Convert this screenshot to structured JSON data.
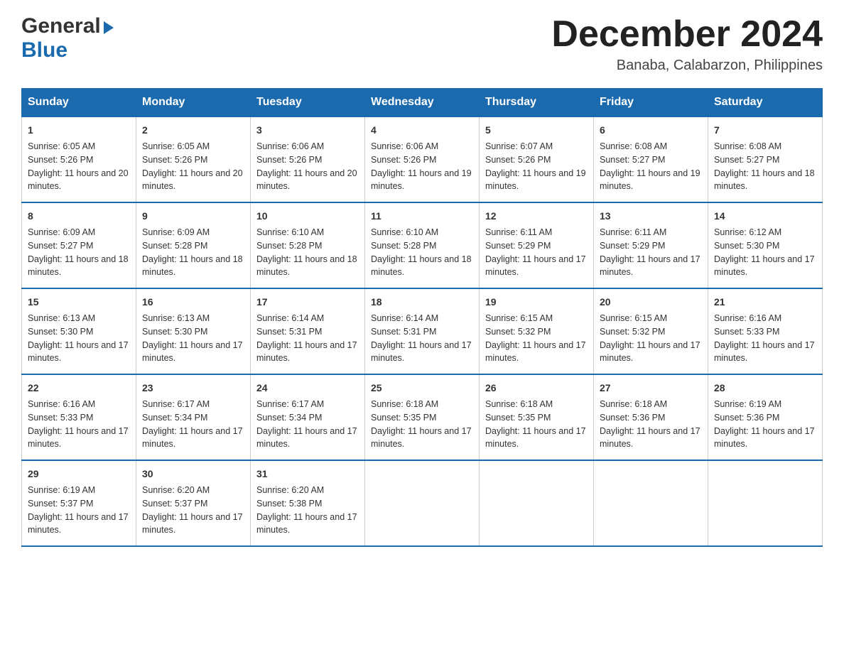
{
  "header": {
    "logo_general": "General",
    "logo_blue": "Blue",
    "month_title": "December 2024",
    "location": "Banaba, Calabarzon, Philippines"
  },
  "calendar": {
    "days_of_week": [
      "Sunday",
      "Monday",
      "Tuesday",
      "Wednesday",
      "Thursday",
      "Friday",
      "Saturday"
    ],
    "weeks": [
      [
        {
          "day": "1",
          "sunrise": "6:05 AM",
          "sunset": "5:26 PM",
          "daylight": "11 hours and 20 minutes."
        },
        {
          "day": "2",
          "sunrise": "6:05 AM",
          "sunset": "5:26 PM",
          "daylight": "11 hours and 20 minutes."
        },
        {
          "day": "3",
          "sunrise": "6:06 AM",
          "sunset": "5:26 PM",
          "daylight": "11 hours and 20 minutes."
        },
        {
          "day": "4",
          "sunrise": "6:06 AM",
          "sunset": "5:26 PM",
          "daylight": "11 hours and 19 minutes."
        },
        {
          "day": "5",
          "sunrise": "6:07 AM",
          "sunset": "5:26 PM",
          "daylight": "11 hours and 19 minutes."
        },
        {
          "day": "6",
          "sunrise": "6:08 AM",
          "sunset": "5:27 PM",
          "daylight": "11 hours and 19 minutes."
        },
        {
          "day": "7",
          "sunrise": "6:08 AM",
          "sunset": "5:27 PM",
          "daylight": "11 hours and 18 minutes."
        }
      ],
      [
        {
          "day": "8",
          "sunrise": "6:09 AM",
          "sunset": "5:27 PM",
          "daylight": "11 hours and 18 minutes."
        },
        {
          "day": "9",
          "sunrise": "6:09 AM",
          "sunset": "5:28 PM",
          "daylight": "11 hours and 18 minutes."
        },
        {
          "day": "10",
          "sunrise": "6:10 AM",
          "sunset": "5:28 PM",
          "daylight": "11 hours and 18 minutes."
        },
        {
          "day": "11",
          "sunrise": "6:10 AM",
          "sunset": "5:28 PM",
          "daylight": "11 hours and 18 minutes."
        },
        {
          "day": "12",
          "sunrise": "6:11 AM",
          "sunset": "5:29 PM",
          "daylight": "11 hours and 17 minutes."
        },
        {
          "day": "13",
          "sunrise": "6:11 AM",
          "sunset": "5:29 PM",
          "daylight": "11 hours and 17 minutes."
        },
        {
          "day": "14",
          "sunrise": "6:12 AM",
          "sunset": "5:30 PM",
          "daylight": "11 hours and 17 minutes."
        }
      ],
      [
        {
          "day": "15",
          "sunrise": "6:13 AM",
          "sunset": "5:30 PM",
          "daylight": "11 hours and 17 minutes."
        },
        {
          "day": "16",
          "sunrise": "6:13 AM",
          "sunset": "5:30 PM",
          "daylight": "11 hours and 17 minutes."
        },
        {
          "day": "17",
          "sunrise": "6:14 AM",
          "sunset": "5:31 PM",
          "daylight": "11 hours and 17 minutes."
        },
        {
          "day": "18",
          "sunrise": "6:14 AM",
          "sunset": "5:31 PM",
          "daylight": "11 hours and 17 minutes."
        },
        {
          "day": "19",
          "sunrise": "6:15 AM",
          "sunset": "5:32 PM",
          "daylight": "11 hours and 17 minutes."
        },
        {
          "day": "20",
          "sunrise": "6:15 AM",
          "sunset": "5:32 PM",
          "daylight": "11 hours and 17 minutes."
        },
        {
          "day": "21",
          "sunrise": "6:16 AM",
          "sunset": "5:33 PM",
          "daylight": "11 hours and 17 minutes."
        }
      ],
      [
        {
          "day": "22",
          "sunrise": "6:16 AM",
          "sunset": "5:33 PM",
          "daylight": "11 hours and 17 minutes."
        },
        {
          "day": "23",
          "sunrise": "6:17 AM",
          "sunset": "5:34 PM",
          "daylight": "11 hours and 17 minutes."
        },
        {
          "day": "24",
          "sunrise": "6:17 AM",
          "sunset": "5:34 PM",
          "daylight": "11 hours and 17 minutes."
        },
        {
          "day": "25",
          "sunrise": "6:18 AM",
          "sunset": "5:35 PM",
          "daylight": "11 hours and 17 minutes."
        },
        {
          "day": "26",
          "sunrise": "6:18 AM",
          "sunset": "5:35 PM",
          "daylight": "11 hours and 17 minutes."
        },
        {
          "day": "27",
          "sunrise": "6:18 AM",
          "sunset": "5:36 PM",
          "daylight": "11 hours and 17 minutes."
        },
        {
          "day": "28",
          "sunrise": "6:19 AM",
          "sunset": "5:36 PM",
          "daylight": "11 hours and 17 minutes."
        }
      ],
      [
        {
          "day": "29",
          "sunrise": "6:19 AM",
          "sunset": "5:37 PM",
          "daylight": "11 hours and 17 minutes."
        },
        {
          "day": "30",
          "sunrise": "6:20 AM",
          "sunset": "5:37 PM",
          "daylight": "11 hours and 17 minutes."
        },
        {
          "day": "31",
          "sunrise": "6:20 AM",
          "sunset": "5:38 PM",
          "daylight": "11 hours and 17 minutes."
        },
        null,
        null,
        null,
        null
      ]
    ]
  }
}
